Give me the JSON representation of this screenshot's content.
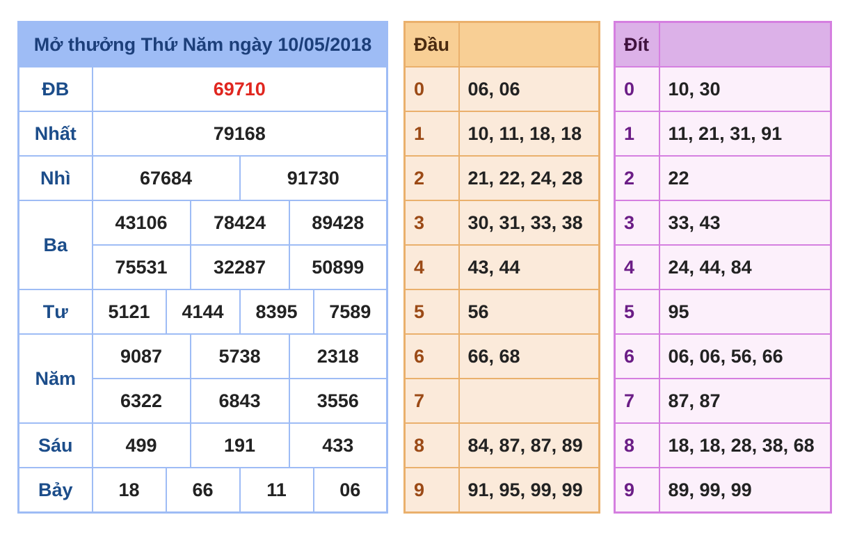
{
  "results": {
    "title": "Mở thưởng Thứ Năm ngày 10/05/2018",
    "db": {
      "label": "ĐB",
      "values": [
        "69710"
      ]
    },
    "nhat": {
      "label": "Nhất",
      "values": [
        "79168"
      ]
    },
    "nhi": {
      "label": "Nhì",
      "values": [
        "67684",
        "91730"
      ]
    },
    "ba": {
      "label": "Ba",
      "values": [
        "43106",
        "78424",
        "89428",
        "75531",
        "32287",
        "50899"
      ]
    },
    "tu": {
      "label": "Tư",
      "values": [
        "5121",
        "4144",
        "8395",
        "7589"
      ]
    },
    "nam": {
      "label": "Năm",
      "values": [
        "9087",
        "5738",
        "2318",
        "6322",
        "6843",
        "3556"
      ]
    },
    "sau": {
      "label": "Sáu",
      "values": [
        "499",
        "191",
        "433"
      ]
    },
    "bay": {
      "label": "Bảy",
      "values": [
        "18",
        "66",
        "11",
        "06"
      ]
    },
    "colors": {
      "border": "#9ebcf5",
      "special": "#e0261f",
      "label": "#1c4d8a"
    }
  },
  "dau": {
    "header": "Đầu",
    "rows": [
      {
        "digit": "0",
        "values": "06, 06"
      },
      {
        "digit": "1",
        "values": "10, 11, 18, 18"
      },
      {
        "digit": "2",
        "values": "21, 22, 24, 28"
      },
      {
        "digit": "3",
        "values": "30, 31, 33, 38"
      },
      {
        "digit": "4",
        "values": "43, 44"
      },
      {
        "digit": "5",
        "values": "56"
      },
      {
        "digit": "6",
        "values": "66, 68"
      },
      {
        "digit": "7",
        "values": ""
      },
      {
        "digit": "8",
        "values": "84, 87, 87, 89"
      },
      {
        "digit": "9",
        "values": "91, 95, 99, 99"
      }
    ],
    "colors": {
      "border": "#eab06c",
      "header_bg": "#f8cf95",
      "body_bg": "#fbeada"
    }
  },
  "dit": {
    "header": "Đít",
    "rows": [
      {
        "digit": "0",
        "values": "10, 30"
      },
      {
        "digit": "1",
        "values": "11, 21, 31, 91"
      },
      {
        "digit": "2",
        "values": "22"
      },
      {
        "digit": "3",
        "values": "33, 43"
      },
      {
        "digit": "4",
        "values": "24, 44, 84"
      },
      {
        "digit": "5",
        "values": "95"
      },
      {
        "digit": "6",
        "values": "06, 06, 56, 66"
      },
      {
        "digit": "7",
        "values": "87, 87"
      },
      {
        "digit": "8",
        "values": "18, 18, 28, 38, 68"
      },
      {
        "digit": "9",
        "values": "89, 99, 99"
      }
    ],
    "colors": {
      "border": "#d57fe0",
      "header_bg": "#dcb1e8",
      "body_bg": "#fcf0fb"
    }
  }
}
